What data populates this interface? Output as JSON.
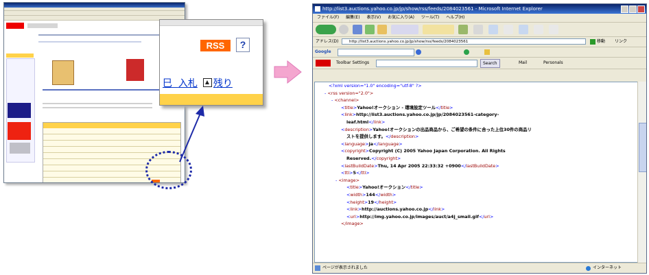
{
  "left_thumbnail": {
    "rss_label": "RSS"
  },
  "zoom": {
    "rss_label": "RSS",
    "help_label": "?",
    "bid_label": "入札",
    "remaining_label": "残り",
    "partial_char": "巳"
  },
  "browser": {
    "title": "http://list3.auctions.yahoo.co.jp/jp/show/rss/feeds/2084023561 - Microsoft Internet Explorer",
    "menu": [
      "ファイル(F)",
      "編集(E)",
      "表示(V)",
      "お気に入り(A)",
      "ツール(T)",
      "ヘルプ(H)"
    ],
    "address_label": "アドレス(D)",
    "address_value": "http://list3.auctions.yahoo.co.jp/jp/show/rss/feeds/2084023561",
    "go_label": "移動",
    "links_label": "リンク",
    "google_label": "Google",
    "search_label": "Search",
    "toolbar_settings": "Toolbar Settings",
    "mail_label": "Mail",
    "personals_label": "Personals",
    "status_text": "ページが表示されました",
    "zone_text": "インターネット"
  },
  "xml": {
    "decl": "<?xml version=\"1.0\" encoding=\"utf-8\" ?>",
    "rss_open": "<rss version=\"2.0\">",
    "channel_open": "<channel>",
    "title_value": "Yahoo!オークション - 環境設定ツール",
    "link_value_1": "http://list3.auctions.yahoo.co.jp/jp/2084023561-category-",
    "link_value_2": "leaf.html",
    "description_value_1": "Yahoo!オークションの出品商品から、ご希望の条件に合った上位30件の商品リ",
    "description_value_2": "ストを提供します。",
    "language_value": "ja",
    "copyright_value_1": "Copyright (C) 2005 Yahoo Japan Corporation. All Rights",
    "copyright_value_2": "Reserved.",
    "lastbuilddate_value": "Thu, 14 Apr 2005 22:33:32 +0900",
    "ttl_value": "5",
    "image_open": "<image>",
    "image_title_value": "Yahoo!オークション",
    "image_width_value": "144",
    "image_height_value": "19",
    "image_link_value": "http://auctions.yahoo.co.jp",
    "image_url_value": "http://img.yahoo.co.jp/images/auct/a4j_small.gif",
    "image_close": "</image>"
  }
}
